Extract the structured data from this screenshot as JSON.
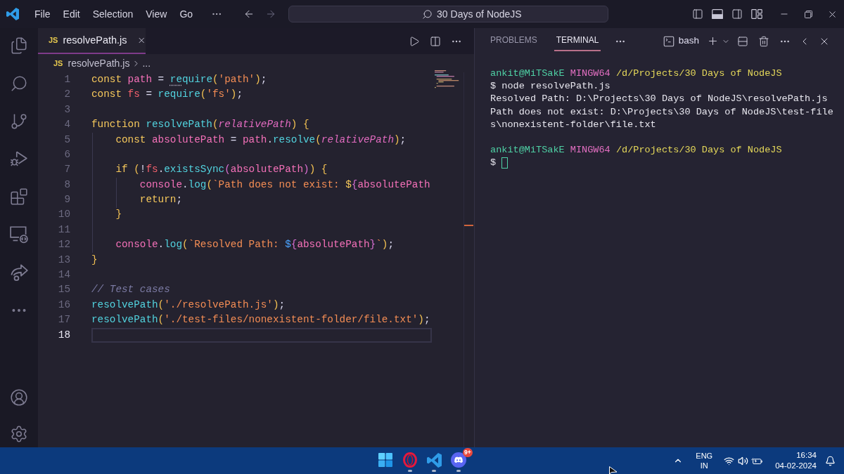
{
  "title_bar": {
    "menu": [
      {
        "label": "File"
      },
      {
        "label": "Edit"
      },
      {
        "label": "Selection"
      },
      {
        "label": "View"
      },
      {
        "label": "Go"
      }
    ],
    "search": "30 Days of NodeJS"
  },
  "editor": {
    "tabs": [
      {
        "file_icon": "JS",
        "label": "resolvePath.js",
        "selected": true
      }
    ],
    "breadcrumb": {
      "file_icon": "JS",
      "file": "resolvePath.js",
      "more": "..."
    },
    "lines": [
      {
        "number": "1",
        "current": false,
        "tokens": [
          {
            "kind": "keyword",
            "text": "const "
          },
          {
            "kind": "variable",
            "text": "path"
          },
          {
            "kind": "operator",
            "text": " = "
          },
          {
            "kind": "function",
            "text": "re",
            "hint": true
          },
          {
            "kind": "function",
            "text": "quire"
          },
          {
            "kind": "bracket",
            "text": "("
          },
          {
            "kind": "string",
            "text": "'path'"
          },
          {
            "kind": "bracket",
            "text": ")"
          },
          {
            "kind": "operator",
            "text": ";"
          }
        ]
      },
      {
        "number": "2",
        "current": false,
        "tokens": [
          {
            "kind": "keyword",
            "text": "const "
          },
          {
            "kind": "module",
            "text": "fs"
          },
          {
            "kind": "operator",
            "text": " = "
          },
          {
            "kind": "function",
            "text": "require"
          },
          {
            "kind": "bracket",
            "text": "("
          },
          {
            "kind": "string",
            "text": "'fs'"
          },
          {
            "kind": "bracket",
            "text": ")"
          },
          {
            "kind": "operator",
            "text": ";"
          }
        ]
      },
      {
        "number": "3",
        "current": false
      },
      {
        "number": "4",
        "current": false,
        "tokens": [
          {
            "kind": "keyword",
            "text": "function "
          },
          {
            "kind": "function",
            "text": "resolvePath"
          },
          {
            "kind": "bracket",
            "text": "("
          },
          {
            "kind": "parameter",
            "text": "relativePath"
          },
          {
            "kind": "bracket",
            "text": ") {"
          }
        ]
      },
      {
        "number": "5",
        "current": false,
        "tokens": [
          {
            "kind": "keyword",
            "text": "    const "
          },
          {
            "kind": "variable",
            "text": "absolutePath"
          },
          {
            "kind": "operator",
            "text": " = "
          },
          {
            "kind": "variable",
            "text": "path"
          },
          {
            "kind": "operator",
            "text": "."
          },
          {
            "kind": "function",
            "text": "resolve"
          },
          {
            "kind": "bracket",
            "text": "("
          },
          {
            "kind": "parameter",
            "text": "relativePath"
          },
          {
            "kind": "bracket",
            "text": ")"
          },
          {
            "kind": "operator",
            "text": ";"
          }
        ]
      },
      {
        "number": "6",
        "current": false
      },
      {
        "number": "7",
        "current": false,
        "tokens": [
          {
            "kind": "keyword",
            "text": "    if "
          },
          {
            "kind": "bracket",
            "text": "("
          },
          {
            "kind": "operator",
            "text": "!"
          },
          {
            "kind": "module",
            "text": "fs"
          },
          {
            "kind": "operator",
            "text": "."
          },
          {
            "kind": "function",
            "text": "existsSync"
          },
          {
            "kind": "bracket2",
            "text": "("
          },
          {
            "kind": "variable",
            "text": "absolutePath"
          },
          {
            "kind": "bracket2",
            "text": ")"
          },
          {
            "kind": "bracket",
            "text": ") {"
          }
        ]
      },
      {
        "number": "8",
        "current": false,
        "tokens": [
          {
            "kind": "variable",
            "text": "        console"
          },
          {
            "kind": "operator",
            "text": "."
          },
          {
            "kind": "function",
            "text": "log"
          },
          {
            "kind": "bracket",
            "text": "("
          },
          {
            "kind": "string",
            "text": "`Path does not exist: "
          },
          {
            "kind": "keyword",
            "text": "$"
          },
          {
            "kind": "bracket2",
            "text": "{"
          },
          {
            "kind": "variable",
            "text": "absolutePath"
          }
        ]
      },
      {
        "number": "9",
        "current": false,
        "tokens": [
          {
            "kind": "keyword",
            "text": "        return"
          },
          {
            "kind": "operator",
            "text": ";"
          }
        ]
      },
      {
        "number": "10",
        "current": false,
        "tokens": [
          {
            "kind": "bracket",
            "text": "    }"
          }
        ]
      },
      {
        "number": "11",
        "current": false
      },
      {
        "number": "12",
        "current": false,
        "tokens": [
          {
            "kind": "variable",
            "text": "    console"
          },
          {
            "kind": "operator",
            "text": "."
          },
          {
            "kind": "function",
            "text": "log"
          },
          {
            "kind": "bracket",
            "text": "("
          },
          {
            "kind": "string",
            "text": "`Resolved Path: "
          },
          {
            "kind": "bracket3",
            "text": "$"
          },
          {
            "kind": "bracket2",
            "text": "{"
          },
          {
            "kind": "variable",
            "text": "absolutePath"
          },
          {
            "kind": "bracket2",
            "text": "}"
          },
          {
            "kind": "string",
            "text": "`"
          },
          {
            "kind": "bracket",
            "text": ")"
          },
          {
            "kind": "operator",
            "text": ";"
          }
        ]
      },
      {
        "number": "13",
        "current": false,
        "tokens": [
          {
            "kind": "bracket",
            "text": "}"
          }
        ]
      },
      {
        "number": "14",
        "current": false
      },
      {
        "number": "15",
        "current": false,
        "tokens": [
          {
            "kind": "comment",
            "text": "// Test cases"
          }
        ]
      },
      {
        "number": "16",
        "current": false,
        "tokens": [
          {
            "kind": "function",
            "text": "resolvePath"
          },
          {
            "kind": "bracket",
            "text": "("
          },
          {
            "kind": "string",
            "text": "'./resolvePath.js'"
          },
          {
            "kind": "bracket",
            "text": ")"
          },
          {
            "kind": "operator",
            "text": ";"
          }
        ]
      },
      {
        "number": "17",
        "current": false,
        "tokens": [
          {
            "kind": "function",
            "text": "resolvePath"
          },
          {
            "kind": "bracket",
            "text": "("
          },
          {
            "kind": "string",
            "text": "'./test-files/nonexistent-folder/file.txt'"
          },
          {
            "kind": "bracket",
            "text": ")"
          },
          {
            "kind": "operator",
            "text": ";"
          }
        ]
      },
      {
        "number": "18",
        "current": true
      }
    ]
  },
  "panel": {
    "tabs": [
      {
        "label": "PROBLEMS",
        "selected": false
      },
      {
        "label": "TERMINAL",
        "selected": true
      }
    ],
    "terminal_name": "bash",
    "lines": [
      {
        "kind": "prompt",
        "user": "ankit@MiTSakE",
        "system": "MINGW64",
        "path": "/d/Projects/30 Days of NodeJS"
      },
      {
        "kind": "output",
        "text": "$ node resolvePath.js"
      },
      {
        "kind": "output",
        "text": "Resolved Path: D:\\Projects\\30 Days of NodeJS\\resolvePath.js"
      },
      {
        "kind": "output",
        "text": "Path does not exist: D:\\Projects\\30 Days of NodeJS\\test-file"
      },
      {
        "kind": "output",
        "text": "s\\nonexistent-folder\\file.txt"
      },
      {
        "kind": "blank"
      },
      {
        "kind": "prompt",
        "user": "ankit@MiTSakE",
        "system": "MINGW64",
        "path": "/d/Projects/30 Days of NodeJS"
      },
      {
        "kind": "input",
        "text": "$",
        "cursor": true
      }
    ]
  },
  "taskbar": {
    "apps": [
      {
        "kind": "start",
        "running": false
      },
      {
        "kind": "browser",
        "running": true
      },
      {
        "kind": "editor",
        "running": true
      },
      {
        "kind": "chat",
        "running": true,
        "badge": "9+"
      }
    ],
    "tray": {
      "language": "ENG",
      "region": "IN",
      "time": "16:34",
      "date": "04-02-2024"
    }
  }
}
